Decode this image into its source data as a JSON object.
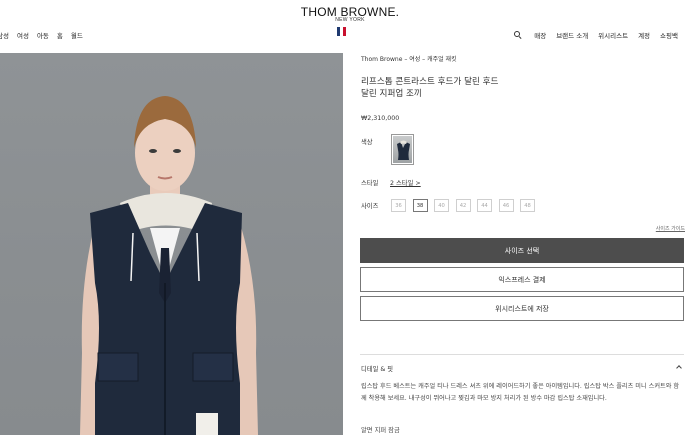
{
  "header": {
    "brand": "THOM BROWNE.",
    "brand_sub": "NEW YORK",
    "flag_colors": [
      "#1f3a70",
      "#ffffff",
      "#c8102e"
    ],
    "nav_left": [
      "남성",
      "여성",
      "아동",
      "홈",
      "월드"
    ],
    "nav_right": [
      "매장",
      "브랜드 소개",
      "위시리스트",
      "계정",
      "쇼핑백"
    ]
  },
  "product": {
    "breadcrumb": "Thom Browne – 여성 – 캐주얼 재킷",
    "title": "리프스톱 콘트라스트 후드가 달린 후드 달린 지퍼업 조끼",
    "price": "₩2,310,000",
    "color_label": "색상",
    "style_label": "스타일",
    "style_value": "2 스타일 >",
    "size_label": "사이즈",
    "sizes": [
      "36",
      "38",
      "40",
      "42",
      "44",
      "46",
      "48"
    ],
    "selected_size": "38",
    "size_guide": "사이즈 가이드",
    "select_size_button": "사이즈 선택",
    "express_checkout_button": "익스프레스 결제",
    "save_wishlist_button": "위시리스트에 저장",
    "details_title": "디테일 & 핏",
    "description": "립스탑 후드 베스트는 캐주얼 티나 드레스 셔츠 위에 레이어드하기 좋은 아이템입니다. 립스탑 박스 플리츠 미니 스커트와 함께 착용해 보세요. 내구성이 뛰어나고 찢김과 마모 방지 처리가 된 방수 마감 립스탑 소재입니다.",
    "care": "알면 지퍼 잠금"
  },
  "colors": {
    "primary_button": "#4d4d4d",
    "photo_background": "#8c9093"
  }
}
